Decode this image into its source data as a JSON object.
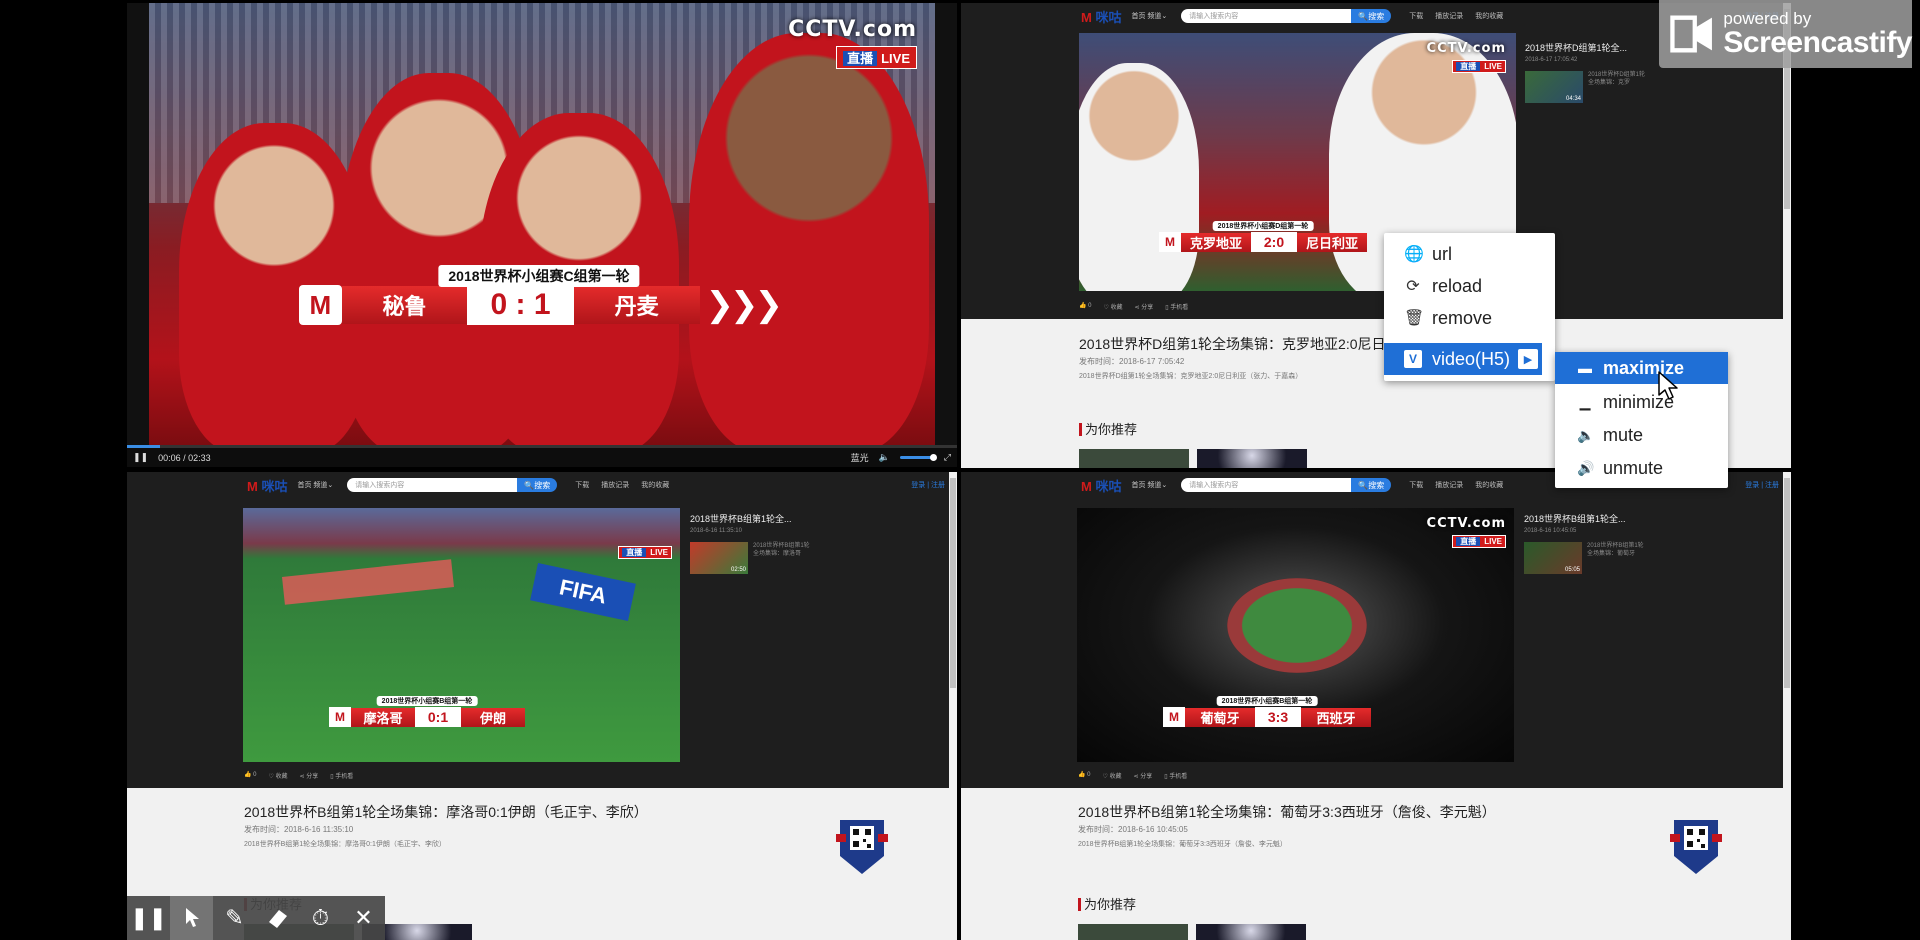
{
  "main_video": {
    "channel_logo": "CCTV.com",
    "live_zh": "直播",
    "live_en": "LIVE",
    "match_title": "2018世界杯小组赛C组第一轮",
    "team_left": "秘鲁",
    "score": "0 : 1",
    "team_right": "丹麦",
    "time": "00:06 / 02:33",
    "quality": "蓝光",
    "progress_fraction": 0.04
  },
  "site": {
    "brand": "咪咕",
    "nav_home": "首页",
    "nav_channel": "频道",
    "search_placeholder": "请输入搜索内容",
    "search_button": "搜索",
    "download": "下载",
    "history": "播放记录",
    "favorites": "我的收藏",
    "login": "登录 | 注册",
    "recommend": "为你推荐"
  },
  "pane_tr": {
    "channel_logo": "CCTV.com",
    "live_zh": "直播",
    "live_en": "LIVE",
    "match_title": "2018世界杯小组赛D组第一轮",
    "team_left": "克罗地亚",
    "score": "2:0",
    "team_right": "尼日利亚",
    "side_title": "2018世界杯D组第1轮全...",
    "side_date": "2018-6-17 17:05:42",
    "side_item_text": "2018世界杯D组第1轮全场集锦：克罗",
    "side_item_dur": "04:34",
    "actions": [
      "0",
      "收藏",
      "分享",
      "手机看"
    ],
    "article_title": "2018世界杯D组第1轮全场集锦：克罗地亚2:0尼日",
    "article_date": "发布时间：2018-6-17 7:05:42",
    "article_desc": "2018世界杯D组第1轮全场集锦：克罗地亚2:0尼日利亚（张力、于嘉森）"
  },
  "pane_bl": {
    "live_zh": "直播",
    "live_en": "LIVE",
    "match_title": "2018世界杯小组赛B组第一轮",
    "team_left": "摩洛哥",
    "score": "0:1",
    "team_right": "伊朗",
    "banner": "FIFA",
    "side_title": "2018世界杯B组第1轮全...",
    "side_date": "2018-6-16 11:35:10",
    "side_item_text": "2018世界杯B组第1轮全场集锦：摩洛哥",
    "side_item_dur": "02:50",
    "actions": [
      "0",
      "收藏",
      "分享",
      "手机看"
    ],
    "article_title": "2018世界杯B组第1轮全场集锦：摩洛哥0:1伊朗（毛正宇、李欣）",
    "article_date": "发布时间：2018-6-16 11:35:10",
    "article_desc": "2018世界杯B组第1轮全场集锦：摩洛哥0:1伊朗（毛正宇、李欣）"
  },
  "pane_br": {
    "channel_logo": "CCTV.com",
    "live_zh": "直播",
    "live_en": "LIVE",
    "match_title": "2018世界杯小组赛B组第一轮",
    "team_left": "葡萄牙",
    "score": "3:3",
    "team_right": "西班牙",
    "side_title": "2018世界杯B组第1轮全...",
    "side_date": "2018-6-16 10:45:05",
    "side_item_text": "2018世界杯B组第1轮全场集锦：葡萄牙",
    "side_item_dur": "05:05",
    "actions": [
      "0",
      "收藏",
      "分享",
      "手机看"
    ],
    "article_title": "2018世界杯B组第1轮全场集锦：葡萄牙3:3西班牙（詹俊、李元魁）",
    "article_date": "发布时间：2018-6-16 10:45:05",
    "article_desc": "2018世界杯B组第1轮全场集锦：葡萄牙3:3西班牙（詹俊、李元魁）"
  },
  "context_menu": {
    "items": [
      {
        "label": "url",
        "icon": "globe-icon"
      },
      {
        "label": "reload",
        "icon": "reload-icon"
      },
      {
        "label": "remove",
        "icon": "trash-icon"
      },
      {
        "label": "video(H5)",
        "icon": "video-h5-icon"
      }
    ],
    "submenu": [
      {
        "label": "maximize",
        "icon": "maximize-icon"
      },
      {
        "label": "minimize",
        "icon": "minimize-icon"
      },
      {
        "label": "mute",
        "icon": "speaker-icon"
      },
      {
        "label": "unmute",
        "icon": "speaker-loud-icon"
      }
    ]
  },
  "watermark": {
    "line1": "powered by",
    "line2": "Screencastify"
  },
  "colors": {
    "accent_blue": "#1f6fd6",
    "brand_red": "#c2141d",
    "live_red": "#d01b1b"
  },
  "toolbar": {
    "tools": [
      "pause-icon",
      "pointer-icon",
      "pen-icon",
      "eraser-icon",
      "timer-icon",
      "close-icon"
    ]
  }
}
